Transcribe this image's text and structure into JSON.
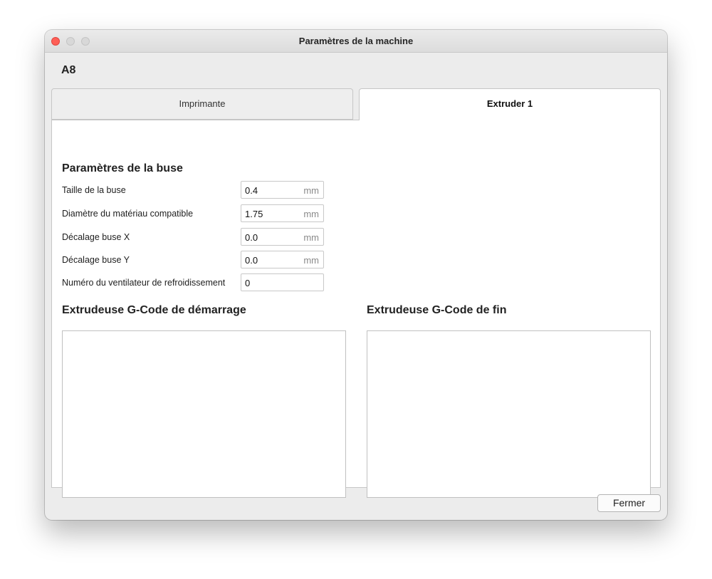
{
  "window": {
    "title": "Paramètres de la machine",
    "machine_name": "A8"
  },
  "tabs": [
    {
      "label": "Imprimante",
      "selected": false
    },
    {
      "label": "Extruder 1",
      "selected": true
    }
  ],
  "nozzle_settings": {
    "title": "Paramètres de la buse",
    "fields": [
      {
        "label": "Taille de la buse",
        "value": "0.4",
        "unit": "mm"
      },
      {
        "label": "Diamètre du matériau compatible",
        "value": "1.75",
        "unit": "mm"
      },
      {
        "label": "Décalage buse X",
        "value": "0.0",
        "unit": "mm"
      },
      {
        "label": "Décalage buse Y",
        "value": "0.0",
        "unit": "mm"
      },
      {
        "label": "Numéro du ventilateur de refroidissement",
        "value": "0",
        "unit": ""
      }
    ]
  },
  "gcode": {
    "start_title": "Extrudeuse G-Code de démarrage",
    "start_value": "",
    "end_title": "Extrudeuse G-Code de fin",
    "end_value": ""
  },
  "footer": {
    "close_label": "Fermer"
  },
  "colors": {
    "close_light": "#fe5f57",
    "window_bg": "#ececec",
    "panel_bg": "#ffffff"
  }
}
